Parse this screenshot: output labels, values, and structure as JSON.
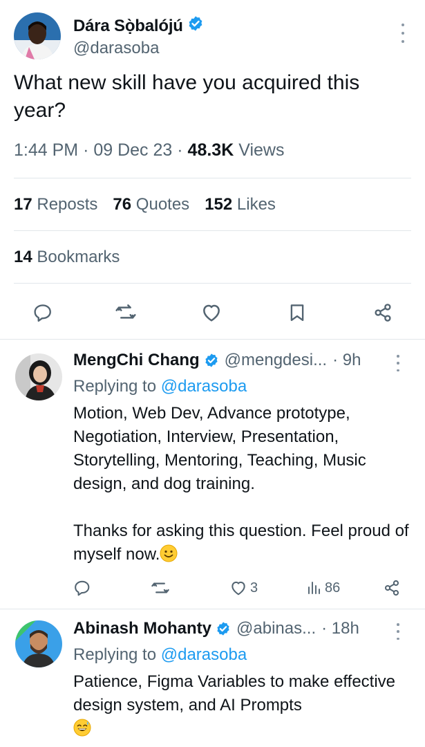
{
  "main_tweet": {
    "author": {
      "name": "Dára Sọ̀balójú",
      "handle": "@darasoba",
      "verified": true
    },
    "text": "What new skill have you acquired this year?",
    "meta": {
      "time": "1:44 PM",
      "date": "09 Dec 23",
      "views_count": "48.3K",
      "views_label": "Views",
      "sep": "·"
    },
    "stats": {
      "reposts": {
        "count": "17",
        "label": "Reposts"
      },
      "quotes": {
        "count": "76",
        "label": "Quotes"
      },
      "likes": {
        "count": "152",
        "label": "Likes"
      },
      "bookmarks": {
        "count": "14",
        "label": "Bookmarks"
      }
    },
    "actions": [
      "reply-icon",
      "repost-icon",
      "like-icon",
      "bookmark-icon",
      "share-icon"
    ]
  },
  "replies": [
    {
      "name": "MengChi Chang",
      "handle": "@mengdesi...",
      "time": "· 9h",
      "verified": true,
      "replying_label": "Replying to",
      "replying_to": "@darasoba",
      "text": "Motion, Web Dev, Advance prototype, Negotiation, Interview, Presentation, Storytelling, Mentoring, Teaching, Music design, and dog training.\n\nThanks for asking this question. Feel proud of myself now.",
      "emoji": "slightly-smiling-face",
      "likes": "3",
      "views": "86"
    },
    {
      "name": "Abinash Mohanty",
      "handle": "@abinas...",
      "time": "· 18h",
      "verified": true,
      "replying_label": "Replying to",
      "replying_to": "@darasoba",
      "text": "Patience, Figma Variables to make effective design system, and AI Prompts",
      "emoji": "grinning-sweat-face"
    }
  ],
  "colors": {
    "accent": "#1d9bf0",
    "secondary_text": "#536471",
    "primary_text": "#0f1419",
    "divider": "#e1e6ea"
  }
}
